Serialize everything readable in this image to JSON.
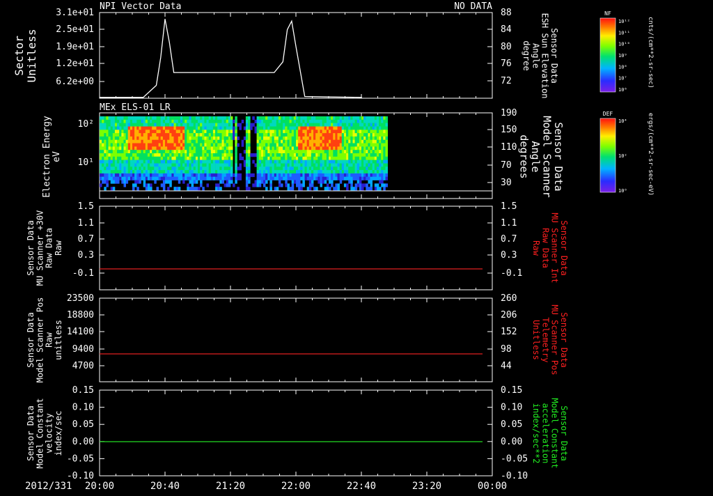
{
  "colors": {
    "background": "#000000",
    "axis": "#ffffff",
    "trace_white": "#ffffff",
    "trace_red": "#e02020",
    "trace_green": "#22dd22",
    "label_red": "#ff2020",
    "label_green": "#22ee22"
  },
  "time_axis": {
    "date_label": "2012/331",
    "ticks": [
      "20:00",
      "20:40",
      "21:20",
      "22:00",
      "22:40",
      "23:20",
      "00:00"
    ]
  },
  "chart_data": [
    {
      "type": "line",
      "panel_title_left": "NPI Vector Data",
      "panel_title_right": "NO DATA",
      "ylabel": [
        "Sector",
        "Unitless"
      ],
      "yticks_left": [
        "3.1e+01",
        "2.5e+01",
        "1.9e+01",
        "1.2e+01",
        "6.2e+00"
      ],
      "ylabel_right": [
        "Sensor Data",
        "ESH Sun Elevation",
        "Angle",
        "degree"
      ],
      "yticks_right": [
        "88",
        "84",
        "80",
        "76",
        "72"
      ],
      "ylim_right": [
        68,
        88
      ],
      "series": [
        {
          "color": "#ffffff",
          "x_minutes": [
            0,
            40,
            52,
            56,
            60,
            64,
            68,
            80,
            120,
            160,
            168,
            172,
            176,
            180,
            188,
            210,
            240,
            280,
            320,
            359
          ],
          "y": [
            68.2,
            68.2,
            71,
            77.5,
            86.5,
            81,
            74,
            74,
            74,
            74,
            76.5,
            84,
            86,
            80,
            68.4,
            68.3,
            68.2,
            68.2,
            68.2,
            68.3
          ]
        }
      ]
    },
    {
      "type": "heatmap",
      "panel_title_left": "MEx ELS-01 LR",
      "ylabel": [
        "Electron Energy",
        "eV"
      ],
      "yticks_left": [
        "10²",
        "10¹"
      ],
      "ylabel_right": [
        "Sensor Data",
        "Model Scanner",
        "Angle",
        "degrees"
      ],
      "yticks_right": [
        "190",
        "150",
        "110",
        "70",
        "30"
      ],
      "ylim_right": [
        10,
        190
      ],
      "data_coverage_minutes": [
        0,
        176
      ],
      "enhancement_intervals_minutes": [
        [
          16,
          52
        ],
        [
          121,
          148
        ]
      ],
      "data_gap_minutes": [
        [
          83,
          98
        ]
      ],
      "colorbar": {
        "label": "DEF",
        "units": "ergs/(cm**2-sr-sec-eV)",
        "ticks": [
          "10⁴",
          "10²",
          "10⁰"
        ]
      }
    },
    {
      "type": "line",
      "ylabel": [
        "Sensor Data",
        "MU Scanner +30V",
        "Raw Data",
        "Raw"
      ],
      "yticks_left": [
        "1.5",
        "1.1",
        "0.7",
        "0.3",
        "-0.1"
      ],
      "ylabel_right": [
        "Sensor Data",
        "MU Scanner Int",
        "Raw Data",
        "Raw"
      ],
      "yticks_right": [
        "1.5",
        "1.1",
        "0.7",
        "0.3",
        "-0.1"
      ],
      "ylim": [
        -0.3,
        1.5
      ],
      "series": [
        {
          "color": "#e02020",
          "x_minutes": [
            0,
            359
          ],
          "y": [
            -0.0,
            -0.0
          ]
        }
      ]
    },
    {
      "type": "line",
      "ylabel": [
        "Sensor Data",
        "Model Scanner Pos",
        "Raw",
        "unitless"
      ],
      "yticks_left": [
        "23500",
        "18800",
        "14100",
        "9400",
        "4700"
      ],
      "ylabel_right": [
        "Sensor Data",
        "MU Scanner Pos",
        "Telemetry",
        "Unitless"
      ],
      "yticks_right": [
        "260",
        "206",
        "152",
        "98",
        "44"
      ],
      "ylim": [
        0,
        23500
      ],
      "series": [
        {
          "color": "#e02020",
          "x_minutes": [
            0,
            359
          ],
          "y": [
            8200,
            8200
          ]
        }
      ]
    },
    {
      "type": "line",
      "ylabel": [
        "Sensor Data",
        "Model Constant",
        "velocity",
        "index/sec"
      ],
      "yticks_left": [
        "0.15",
        "0.10",
        "0.05",
        "0.00",
        "-0.05",
        "-0.10"
      ],
      "ylabel_right": [
        "Sensor Data",
        "Model Constant",
        "acceleration",
        "index/sec**2"
      ],
      "yticks_right": [
        "0.15",
        "0.10",
        "0.05",
        "0.00",
        "-0.05",
        "-0.10"
      ],
      "ylim": [
        -0.1,
        0.15
      ],
      "series": [
        {
          "color": "#22dd22",
          "x_minutes": [
            0,
            359
          ],
          "y": [
            0.0,
            0.0
          ]
        }
      ]
    }
  ],
  "colorbar_nf": {
    "label": "NF",
    "units": "cnts/(cm**2-sr-sec)",
    "ticks": [
      "10¹²",
      "10¹¹",
      "10¹⁰",
      "10⁹",
      "10⁸",
      "10⁷",
      "10⁶"
    ]
  }
}
